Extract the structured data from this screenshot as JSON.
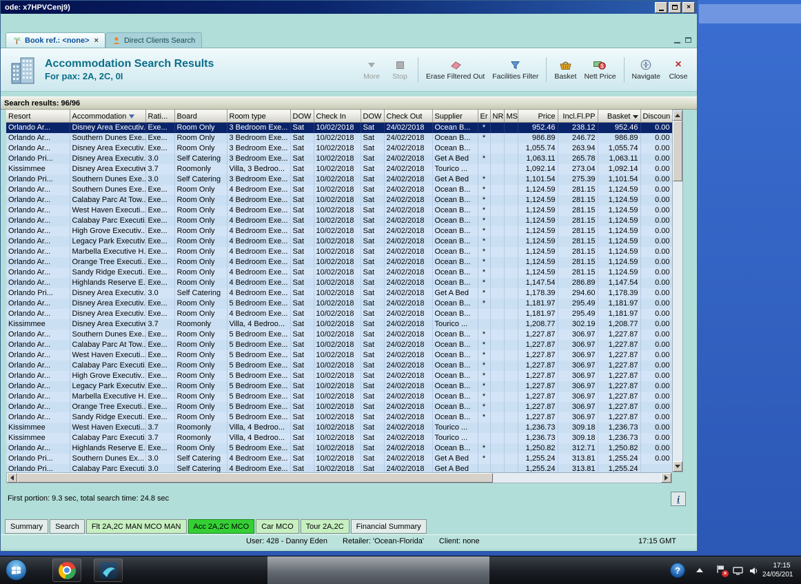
{
  "window": {
    "title": "ode: x7HPVCenj9)"
  },
  "icons": {
    "close_glyph": "×",
    "help_glyph": "?",
    "info_glyph": "i"
  },
  "doc_tabs": [
    {
      "label": "Book ref.: <none>"
    },
    {
      "label": "Direct Clients Search"
    }
  ],
  "header": {
    "title": "Accommodation Search Results",
    "subtitle": "For pax: 2A, 2C, 0I",
    "toolbar": [
      {
        "label": "More"
      },
      {
        "label": "Stop"
      },
      {
        "label": "Erase Filtered Out"
      },
      {
        "label": "Facilities Filter"
      },
      {
        "label": "Basket"
      },
      {
        "label": "Nett Price"
      },
      {
        "label": "Navigate"
      },
      {
        "label": "Close"
      }
    ]
  },
  "results_bar": {
    "label": "Search results: 96/96"
  },
  "table": {
    "columns": [
      {
        "label": "Resort"
      },
      {
        "label": "Accommodation",
        "icon": "filter"
      },
      {
        "label": "Rati..."
      },
      {
        "label": "Board"
      },
      {
        "label": "Room type"
      },
      {
        "label": "DOW"
      },
      {
        "label": "Check In"
      },
      {
        "label": "DOW"
      },
      {
        "label": "Check Out"
      },
      {
        "label": "Supplier"
      },
      {
        "label": "Er"
      },
      {
        "label": "NR"
      },
      {
        "label": "MS"
      },
      {
        "label": "Price"
      },
      {
        "label": "Incl.Fl.PP"
      },
      {
        "label": "Basket",
        "icon": "sort-desc"
      },
      {
        "label": "Discoun"
      }
    ],
    "selected_row": 0,
    "rows": [
      [
        "Orlando Ar...",
        "Disney Area Executiv...",
        "Exe...",
        "Room Only",
        "3 Bedroom Exe...",
        "Sat",
        "10/02/2018",
        "Sat",
        "24/02/2018",
        "Ocean B...",
        "*",
        "",
        "",
        "952.46",
        "238.12",
        "952.46",
        "0.00"
      ],
      [
        "Orlando Ar...",
        "Southern Dunes Exe...",
        "Exe...",
        "Room Only",
        "3 Bedroom Exe...",
        "Sat",
        "10/02/2018",
        "Sat",
        "24/02/2018",
        "Ocean B...",
        "*",
        "",
        "",
        "986.89",
        "246.72",
        "986.89",
        "0.00"
      ],
      [
        "Orlando Ar...",
        "Disney Area Executiv...",
        "Exe...",
        "Room Only",
        "3 Bedroom Exe...",
        "Sat",
        "10/02/2018",
        "Sat",
        "24/02/2018",
        "Ocean B...",
        "",
        "",
        "",
        "1,055.74",
        "263.94",
        "1,055.74",
        "0.00"
      ],
      [
        "Orlando Pri...",
        "Disney Area Executiv...",
        "3.0",
        "Self Catering",
        "3 Bedroom Exe...",
        "Sat",
        "10/02/2018",
        "Sat",
        "24/02/2018",
        "Get A Bed",
        "*",
        "",
        "",
        "1,063.11",
        "265.78",
        "1,063.11",
        "0.00"
      ],
      [
        "Kissimmee",
        "Disney Area Executive",
        "3.7",
        "Roomonly",
        "Villa, 3 Bedroo...",
        "Sat",
        "10/02/2018",
        "Sat",
        "24/02/2018",
        "Tourico ...",
        "",
        "",
        "",
        "1,092.14",
        "273.04",
        "1,092.14",
        "0.00"
      ],
      [
        "Orlando Pri...",
        "Southern Dunes Exe...",
        "3.0",
        "Self Catering",
        "3 Bedroom Exe...",
        "Sat",
        "10/02/2018",
        "Sat",
        "24/02/2018",
        "Get A Bed",
        "*",
        "",
        "",
        "1,101.54",
        "275.39",
        "1,101.54",
        "0.00"
      ],
      [
        "Orlando Ar...",
        "Southern Dunes Exe...",
        "Exe...",
        "Room Only",
        "4 Bedroom Exe...",
        "Sat",
        "10/02/2018",
        "Sat",
        "24/02/2018",
        "Ocean B...",
        "*",
        "",
        "",
        "1,124.59",
        "281.15",
        "1,124.59",
        "0.00"
      ],
      [
        "Orlando Ar...",
        "Calabay Parc At Tow...",
        "Exe...",
        "Room Only",
        "4 Bedroom Exe...",
        "Sat",
        "10/02/2018",
        "Sat",
        "24/02/2018",
        "Ocean B...",
        "*",
        "",
        "",
        "1,124.59",
        "281.15",
        "1,124.59",
        "0.00"
      ],
      [
        "Orlando Ar...",
        "West Haven Executi...",
        "Exe...",
        "Room Only",
        "4 Bedroom Exe...",
        "Sat",
        "10/02/2018",
        "Sat",
        "24/02/2018",
        "Ocean B...",
        "*",
        "",
        "",
        "1,124.59",
        "281.15",
        "1,124.59",
        "0.00"
      ],
      [
        "Orlando Ar...",
        "Calabay Parc Executi...",
        "Exe...",
        "Room Only",
        "4 Bedroom Exe...",
        "Sat",
        "10/02/2018",
        "Sat",
        "24/02/2018",
        "Ocean B...",
        "*",
        "",
        "",
        "1,124.59",
        "281.15",
        "1,124.59",
        "0.00"
      ],
      [
        "Orlando Ar...",
        "High Grove Executiv...",
        "Exe...",
        "Room Only",
        "4 Bedroom Exe...",
        "Sat",
        "10/02/2018",
        "Sat",
        "24/02/2018",
        "Ocean B...",
        "*",
        "",
        "",
        "1,124.59",
        "281.15",
        "1,124.59",
        "0.00"
      ],
      [
        "Orlando Ar...",
        "Legacy Park Executiv...",
        "Exe...",
        "Room Only",
        "4 Bedroom Exe...",
        "Sat",
        "10/02/2018",
        "Sat",
        "24/02/2018",
        "Ocean B...",
        "*",
        "",
        "",
        "1,124.59",
        "281.15",
        "1,124.59",
        "0.00"
      ],
      [
        "Orlando Ar...",
        "Marbella Executive H...",
        "Exe...",
        "Room Only",
        "4 Bedroom Exe...",
        "Sat",
        "10/02/2018",
        "Sat",
        "24/02/2018",
        "Ocean B...",
        "*",
        "",
        "",
        "1,124.59",
        "281.15",
        "1,124.59",
        "0.00"
      ],
      [
        "Orlando Ar...",
        "Orange Tree Executi...",
        "Exe...",
        "Room Only",
        "4 Bedroom Exe...",
        "Sat",
        "10/02/2018",
        "Sat",
        "24/02/2018",
        "Ocean B...",
        "*",
        "",
        "",
        "1,124.59",
        "281.15",
        "1,124.59",
        "0.00"
      ],
      [
        "Orlando Ar...",
        "Sandy Ridge Executi...",
        "Exe...",
        "Room Only",
        "4 Bedroom Exe...",
        "Sat",
        "10/02/2018",
        "Sat",
        "24/02/2018",
        "Ocean B...",
        "*",
        "",
        "",
        "1,124.59",
        "281.15",
        "1,124.59",
        "0.00"
      ],
      [
        "Orlando Ar...",
        "Highlands Reserve E...",
        "Exe...",
        "Room Only",
        "4 Bedroom Exe...",
        "Sat",
        "10/02/2018",
        "Sat",
        "24/02/2018",
        "Ocean B...",
        "*",
        "",
        "",
        "1,147.54",
        "286.89",
        "1,147.54",
        "0.00"
      ],
      [
        "Orlando Pri...",
        "Disney Area Executiv...",
        "3.0",
        "Self Catering",
        "4 Bedroom Exe...",
        "Sat",
        "10/02/2018",
        "Sat",
        "24/02/2018",
        "Get A Bed",
        "*",
        "",
        "",
        "1,178.39",
        "294.60",
        "1,178.39",
        "0.00"
      ],
      [
        "Orlando Ar...",
        "Disney Area Executiv...",
        "Exe...",
        "Room Only",
        "5 Bedroom Exe...",
        "Sat",
        "10/02/2018",
        "Sat",
        "24/02/2018",
        "Ocean B...",
        "*",
        "",
        "",
        "1,181.97",
        "295.49",
        "1,181.97",
        "0.00"
      ],
      [
        "Orlando Ar...",
        "Disney Area Executiv...",
        "Exe...",
        "Room Only",
        "4 Bedroom Exe...",
        "Sat",
        "10/02/2018",
        "Sat",
        "24/02/2018",
        "Ocean B...",
        "",
        "",
        "",
        "1,181.97",
        "295.49",
        "1,181.97",
        "0.00"
      ],
      [
        "Kissimmee",
        "Disney Area Executive",
        "3.7",
        "Roomonly",
        "Villa, 4 Bedroo...",
        "Sat",
        "10/02/2018",
        "Sat",
        "24/02/2018",
        "Tourico ...",
        "",
        "",
        "",
        "1,208.77",
        "302.19",
        "1,208.77",
        "0.00"
      ],
      [
        "Orlando Ar...",
        "Southern Dunes Exe...",
        "Exe...",
        "Room Only",
        "5 Bedroom Exe...",
        "Sat",
        "10/02/2018",
        "Sat",
        "24/02/2018",
        "Ocean B...",
        "*",
        "",
        "",
        "1,227.87",
        "306.97",
        "1,227.87",
        "0.00"
      ],
      [
        "Orlando Ar...",
        "Calabay Parc At Tow...",
        "Exe...",
        "Room Only",
        "5 Bedroom Exe...",
        "Sat",
        "10/02/2018",
        "Sat",
        "24/02/2018",
        "Ocean B...",
        "*",
        "",
        "",
        "1,227.87",
        "306.97",
        "1,227.87",
        "0.00"
      ],
      [
        "Orlando Ar...",
        "West Haven Executi...",
        "Exe...",
        "Room Only",
        "5 Bedroom Exe...",
        "Sat",
        "10/02/2018",
        "Sat",
        "24/02/2018",
        "Ocean B...",
        "*",
        "",
        "",
        "1,227.87",
        "306.97",
        "1,227.87",
        "0.00"
      ],
      [
        "Orlando Ar...",
        "Calabay Parc Executi...",
        "Exe...",
        "Room Only",
        "5 Bedroom Exe...",
        "Sat",
        "10/02/2018",
        "Sat",
        "24/02/2018",
        "Ocean B...",
        "*",
        "",
        "",
        "1,227.87",
        "306.97",
        "1,227.87",
        "0.00"
      ],
      [
        "Orlando Ar...",
        "High Grove Executiv...",
        "Exe...",
        "Room Only",
        "5 Bedroom Exe...",
        "Sat",
        "10/02/2018",
        "Sat",
        "24/02/2018",
        "Ocean B...",
        "*",
        "",
        "",
        "1,227.87",
        "306.97",
        "1,227.87",
        "0.00"
      ],
      [
        "Orlando Ar...",
        "Legacy Park Executiv...",
        "Exe...",
        "Room Only",
        "5 Bedroom Exe...",
        "Sat",
        "10/02/2018",
        "Sat",
        "24/02/2018",
        "Ocean B...",
        "*",
        "",
        "",
        "1,227.87",
        "306.97",
        "1,227.87",
        "0.00"
      ],
      [
        "Orlando Ar...",
        "Marbella Executive H...",
        "Exe...",
        "Room Only",
        "5 Bedroom Exe...",
        "Sat",
        "10/02/2018",
        "Sat",
        "24/02/2018",
        "Ocean B...",
        "*",
        "",
        "",
        "1,227.87",
        "306.97",
        "1,227.87",
        "0.00"
      ],
      [
        "Orlando Ar...",
        "Orange Tree Executi...",
        "Exe...",
        "Room Only",
        "5 Bedroom Exe...",
        "Sat",
        "10/02/2018",
        "Sat",
        "24/02/2018",
        "Ocean B...",
        "*",
        "",
        "",
        "1,227.87",
        "306.97",
        "1,227.87",
        "0.00"
      ],
      [
        "Orlando Ar...",
        "Sandy Ridge Executi...",
        "Exe...",
        "Room Only",
        "5 Bedroom Exe...",
        "Sat",
        "10/02/2018",
        "Sat",
        "24/02/2018",
        "Ocean B...",
        "*",
        "",
        "",
        "1,227.87",
        "306.97",
        "1,227.87",
        "0.00"
      ],
      [
        "Kissimmee",
        "West Haven Executi...",
        "3.7",
        "Roomonly",
        "Villa, 4 Bedroo...",
        "Sat",
        "10/02/2018",
        "Sat",
        "24/02/2018",
        "Tourico ...",
        "",
        "",
        "",
        "1,236.73",
        "309.18",
        "1,236.73",
        "0.00"
      ],
      [
        "Kissimmee",
        "Calabay Parc Executi...",
        "3.7",
        "Roomonly",
        "Villa, 4 Bedroo...",
        "Sat",
        "10/02/2018",
        "Sat",
        "24/02/2018",
        "Tourico ...",
        "",
        "",
        "",
        "1,236.73",
        "309.18",
        "1,236.73",
        "0.00"
      ],
      [
        "Orlando Ar...",
        "Highlands Reserve E...",
        "Exe...",
        "Room Only",
        "5 Bedroom Exe...",
        "Sat",
        "10/02/2018",
        "Sat",
        "24/02/2018",
        "Ocean B...",
        "*",
        "",
        "",
        "1,250.82",
        "312.71",
        "1,250.82",
        "0.00"
      ],
      [
        "Orlando Pri...",
        "Southern Dunes Ex...",
        "3.0",
        "Self Catering",
        "4 Bedroom Exe...",
        "Sat",
        "10/02/2018",
        "Sat",
        "24/02/2018",
        "Get A Bed",
        "*",
        "",
        "",
        "1,255.24",
        "313.81",
        "1,255.24",
        "0.00"
      ],
      [
        "Orlando Pri...",
        "Calabay Parc Executi...",
        "3.0",
        "Self Catering",
        "4 Bedroom Exe...",
        "Sat",
        "10/02/2018",
        "Sat",
        "24/02/2018",
        "Get A Bed",
        "",
        "",
        "",
        "1,255.24",
        "313.81",
        "1,255.24",
        ""
      ]
    ]
  },
  "footer": {
    "timing": "First portion: 9.3 sec, total search time: 24.8 sec"
  },
  "bottom_tabs": [
    {
      "label": "Summary",
      "style": "plain"
    },
    {
      "label": "Search",
      "style": "plain"
    },
    {
      "label": "Flt 2A,2C MAN MCO MAN",
      "style": "green-light"
    },
    {
      "label": "Acc 2A,2C MCO",
      "style": "green-active"
    },
    {
      "label": "Car MCO",
      "style": "green-light"
    },
    {
      "label": "Tour 2A,2C",
      "style": "green-light"
    },
    {
      "label": "Financial Summary",
      "style": "plain"
    }
  ],
  "status_bar": {
    "user": "User: 428 - Danny Eden",
    "retailer": "Retailer: 'Ocean-Florida'",
    "client": "Client: none",
    "time": "17:15 GMT"
  },
  "taskbar": {
    "clock_time": "17:15",
    "clock_date": "24/05/201"
  }
}
